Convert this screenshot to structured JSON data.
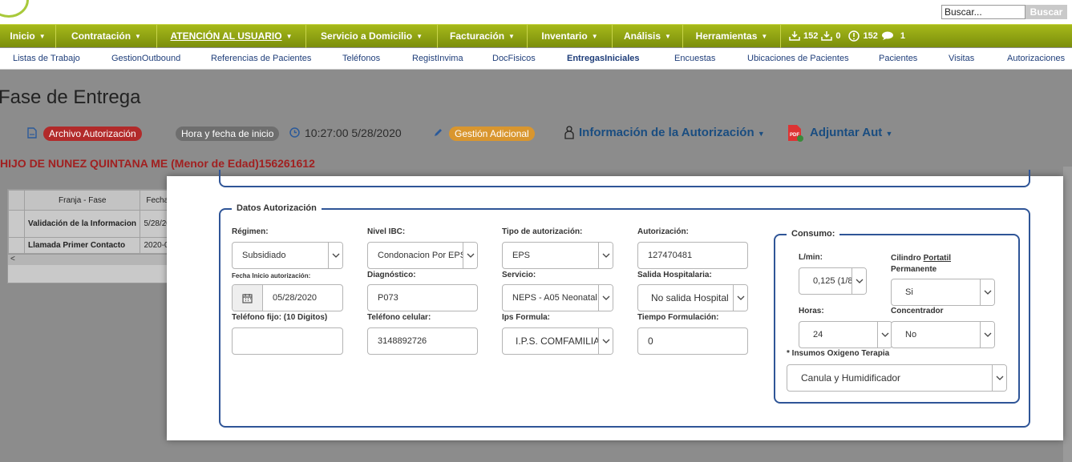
{
  "nav": {
    "items": [
      {
        "label": "Inicio"
      },
      {
        "label": "Contratación"
      },
      {
        "label": "ATENCIÓN AL USUARIO"
      },
      {
        "label": "Servicio a Domicilio"
      },
      {
        "label": "Facturación"
      },
      {
        "label": "Inventario"
      },
      {
        "label": "Análisis"
      },
      {
        "label": "Herramientas"
      }
    ],
    "counters": {
      "inbox": "152",
      "outbox": "0",
      "alerts": "152",
      "messages": "1"
    },
    "search": {
      "value": "Buscar...",
      "button": "Buscar"
    }
  },
  "subnav": {
    "items": [
      "Listas de Trabajo",
      "GestionOutbound",
      "Referencias de Pacientes",
      "Teléfonos",
      "RegistInvima",
      "DocFisicos",
      "EntregasIniciales",
      "Encuestas",
      "Ubicaciones de Pacientes",
      "Pacientes",
      "Visitas",
      "Autorizaciones"
    ],
    "active": "EntregasIniciales"
  },
  "page": {
    "title": "Fase de Entrega",
    "archivo": "Archivo Autorización",
    "hora_label": "Hora y fecha de inicio",
    "hora_value": "10:27:00 5/28/2020",
    "gestion": "Gestión Adicional",
    "info_autorizacion": "Información de la Autorización",
    "adjuntar": "Adjuntar Aut",
    "patient": "HIJO DE NUNEZ QUINTANA ME (Menor de Edad)156261612"
  },
  "bg_table": {
    "headers": [
      "Franja - Fase",
      "Fecha"
    ],
    "rows": [
      [
        "Validación de la Informacion",
        "5/28/20"
      ],
      [
        "Llamada Primer Contacto",
        "2020-0"
      ]
    ]
  },
  "form": {
    "legend": "Datos Autorización",
    "regimen": {
      "label": "Régimen:",
      "value": "Subsidiado"
    },
    "nivel_ibc": {
      "label": "Nivel IBC:",
      "value": "Condonacion Por EPS"
    },
    "tipo_autorizacion": {
      "label": "Tipo de autorización:",
      "value": "EPS"
    },
    "autorizacion": {
      "label": "Autorización:",
      "value": "127470481"
    },
    "fecha_inicio": {
      "label": "Fecha Inicio autorización:",
      "value": "05/28/2020"
    },
    "diagnostico": {
      "label": "Diagnóstico:",
      "value": "P073"
    },
    "servicio": {
      "label": "Servicio:",
      "value": "NEPS - A05 Neonatal"
    },
    "salida": {
      "label": "Salida Hospitalaria:",
      "value": "No salida Hospital"
    },
    "telefono_fijo": {
      "label": "Teléfono fijo: (10 Digitos)",
      "value": ""
    },
    "telefono_celular": {
      "label": "Teléfono celular:",
      "value": "3148892726"
    },
    "ips_formula": {
      "label": "Ips Formula:",
      "value": "I.P.S. COMFAMILIAR"
    },
    "tiempo_formulacion": {
      "label": "Tiempo Formulación:",
      "value": "0"
    }
  },
  "consumo": {
    "legend": "Consumo:",
    "lmin": {
      "label": "L/min:",
      "value": "0,125 (1/8"
    },
    "cilindro": {
      "label_pre": "Cilindro ",
      "label_u": "Portatil",
      "label_post": "Permanente",
      "value": "Si"
    },
    "horas": {
      "label": "Horas:",
      "value": "24"
    },
    "concentrador": {
      "label": "Concentrador",
      "value": "No"
    },
    "insumos": {
      "label": "* Insumos Oxigeno Terapia",
      "value": "Canula y Humidificador"
    }
  },
  "colors": {
    "nav_green": "#8fa316",
    "pill_red": "#b22a2a",
    "pill_gray": "#6e6e6e",
    "pill_orange": "#d9962e",
    "border_blue": "#2f5597",
    "patient_red": "#a12020"
  }
}
